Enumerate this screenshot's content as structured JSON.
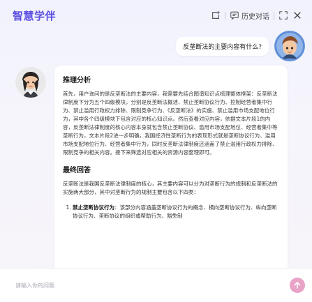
{
  "header": {
    "brand": "智慧学伴",
    "history_label": "历史对话",
    "icons": [
      "new-chat-icon",
      "history-icon",
      "expand-icon",
      "close-icon"
    ]
  },
  "user_message": {
    "text": "反垄断法的主要内容有什么?"
  },
  "assistant_message": {
    "reasoning_title": "推理分析",
    "reasoning_text": "首先，用户询问的是反垄断法的主要内容，我需要先结合图谱知识点梳理整体框架：反垄断法律制度下分为五个四级模块，分别是反垄断法概述、禁止垄断协议行为、控制经营者集中行为、禁止滥用行政权力排除、限制竞争行为、《反垄断法》的实施、禁止滥用市场支配地位行为，其中各个四级模块下包含对应的核心知识点。然后查看对应内容，依据文本片段1的内容，反垄断法律制度的核心内容本身就包含禁止垄断协议、滥用市场支配地位、经营者集中等垄断行为，文本片段2进一步明确，我国经济性垄断行为的表现形式就是垄断协议行为、滥用市场支配地位行为、经营者集中行为，同时反垄断法律制度还涵盖了禁止滥用行政权力排除、限制竞争的相关内容。接下来筛选对应相关的资源内容整理即可。",
    "answer_title": "最终回答",
    "answer_intro": "反垄断法是我国反垄断法律制度的核心，其主要内容可以分为对垄断行为的规制和反垄断法的实施两大部分，其中对垄断行为的规制主要包含以下四类：",
    "list_items": [
      {
        "title": "禁止垄断协议行为",
        "text": "：该部分内容涵盖垄断协议行为的概念、横向垄断协议行为、纵向垄断协议行为、垄断协议的组织或帮助行为、豁免制"
      }
    ]
  },
  "composer": {
    "placeholder": "请输入你的问题"
  },
  "colors": {
    "brand": "#5b4de0",
    "send_button": "#e8a3c6"
  }
}
